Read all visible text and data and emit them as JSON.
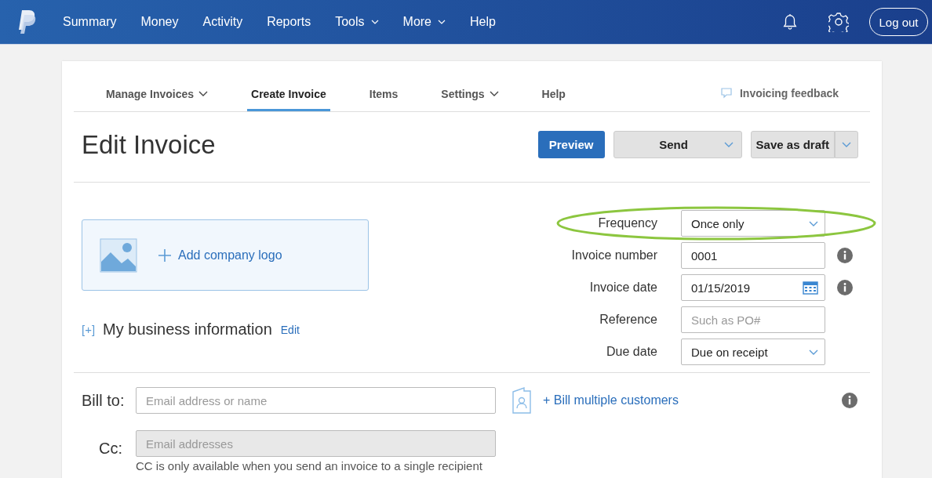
{
  "header": {
    "nav": [
      {
        "label": "Summary",
        "dropdown": false
      },
      {
        "label": "Money",
        "dropdown": false
      },
      {
        "label": "Activity",
        "dropdown": false
      },
      {
        "label": "Reports",
        "dropdown": false
      },
      {
        "label": "Tools",
        "dropdown": true
      },
      {
        "label": "More",
        "dropdown": true
      },
      {
        "label": "Help",
        "dropdown": false
      }
    ],
    "logout": "Log out"
  },
  "tabs": [
    {
      "label": "Manage Invoices",
      "dropdown": true,
      "selected": false
    },
    {
      "label": "Create Invoice",
      "dropdown": false,
      "selected": true
    },
    {
      "label": "Items",
      "dropdown": false,
      "selected": false
    },
    {
      "label": "Settings",
      "dropdown": true,
      "selected": false
    },
    {
      "label": "Help",
      "dropdown": false,
      "selected": false
    }
  ],
  "feedback": "Invoicing feedback",
  "title": "Edit Invoice",
  "actions": {
    "preview": "Preview",
    "send": "Send",
    "save": "Save as draft"
  },
  "logo": {
    "label": "Add company logo"
  },
  "business": {
    "toggle": "[+]",
    "label": "My business information",
    "edit": "Edit"
  },
  "fields": [
    {
      "label": "Frequency",
      "kind": "select",
      "value": "Once only",
      "info": false,
      "highlighted": true
    },
    {
      "label": "Invoice number",
      "kind": "text",
      "value": "0001",
      "info": true,
      "highlighted": false
    },
    {
      "label": "Invoice date",
      "kind": "date",
      "value": "01/15/2019",
      "info": true,
      "highlighted": false
    },
    {
      "label": "Reference",
      "kind": "text",
      "placeholder": "Such as PO#",
      "info": false,
      "highlighted": false
    },
    {
      "label": "Due date",
      "kind": "select",
      "value": "Due on receipt",
      "info": false,
      "highlighted": false
    }
  ],
  "bill_to": {
    "label": "Bill to:",
    "placeholder": "Email address or name",
    "multiple": "+ Bill multiple customers"
  },
  "cc": {
    "label": "Cc:",
    "placeholder": "Email addresses",
    "disabled": true,
    "note": "CC is only available when you send an invoice to a single recipient"
  }
}
